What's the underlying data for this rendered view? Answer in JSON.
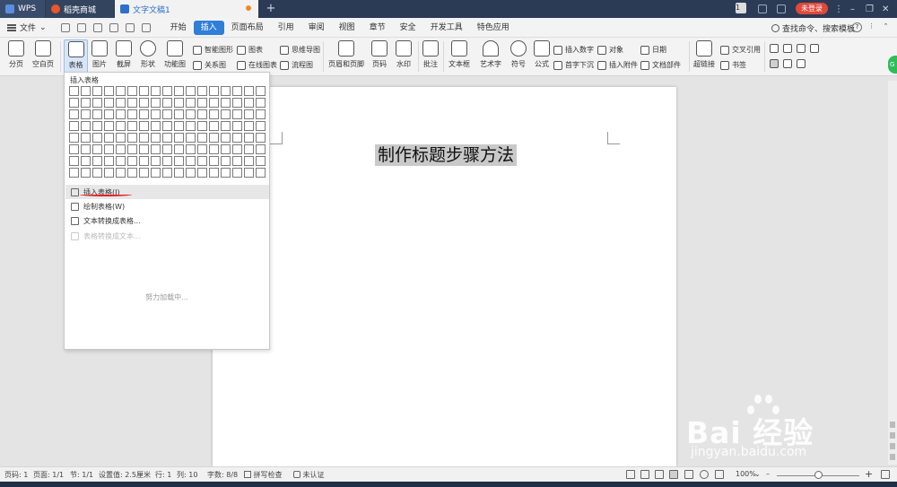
{
  "titlebar": {
    "tabs": [
      {
        "label": "WPS"
      },
      {
        "label": "稻壳商城"
      },
      {
        "label": "文字文稿1"
      }
    ],
    "badge": "1",
    "login": "未登录"
  },
  "menubar": {
    "file": "文件",
    "items": [
      "开始",
      "插入",
      "页面布局",
      "引用",
      "审阅",
      "视图",
      "章节",
      "安全",
      "开发工具",
      "特色应用"
    ],
    "active": "插入",
    "search": "查找命令、搜索模板"
  },
  "ribbon": {
    "page_break": "分页",
    "blank_page": "空白页",
    "table": "表格",
    "picture": "图片",
    "screenshot": "截屏",
    "shape": "形状",
    "function_chart": "功能图",
    "smart_shape": "智能图形",
    "chart": "图表",
    "mind_map": "思维导图",
    "relation_chart": "关系图",
    "online_chart": "在线图表",
    "flowchart": "流程图",
    "header_footer": "页眉和页脚",
    "page_number": "页码",
    "watermark": "水印",
    "comment": "批注",
    "textbox": "文本框",
    "wordart": "艺术字",
    "symbol": "符号",
    "formula": "公式",
    "insert_number": "插入数字",
    "object": "对象",
    "dropcap": "首字下沉",
    "insert_attachment": "插入附件",
    "date": "日期",
    "doc_parts": "文档部件",
    "hyperlink": "超链接",
    "crossref": "交叉引用",
    "bookmark": "书签"
  },
  "dropdown": {
    "header": "插入表格",
    "rows": 8,
    "cols": 17,
    "items": [
      {
        "label": "插入表格(I)",
        "highlight": true,
        "disabled": false
      },
      {
        "label": "绘制表格(W)",
        "highlight": false,
        "disabled": false
      },
      {
        "label": "文本转换成表格...",
        "highlight": false,
        "disabled": false
      },
      {
        "label": "表格转换成文本...",
        "highlight": false,
        "disabled": true
      }
    ],
    "loading": "努力加载中..."
  },
  "document": {
    "title": "制作标题步骤方法"
  },
  "statusbar": {
    "page_num": "页码: 1",
    "pages": "页面: 1/1",
    "section": "节: 1/1",
    "setting": "设置值: 2.5厘米",
    "row": "行: 1",
    "col": "列: 10",
    "words": "字数: 8/8",
    "spell": "拼写检查",
    "cert": "未认证",
    "zoom": "100%"
  },
  "watermark": {
    "brand": "Bai 经验",
    "url": "jingyan.baidu.com"
  },
  "colors": {
    "titlebar": "#2b3b55",
    "accent": "#2f7ed8",
    "login": "#e0483c",
    "underline": "#e5232b"
  }
}
